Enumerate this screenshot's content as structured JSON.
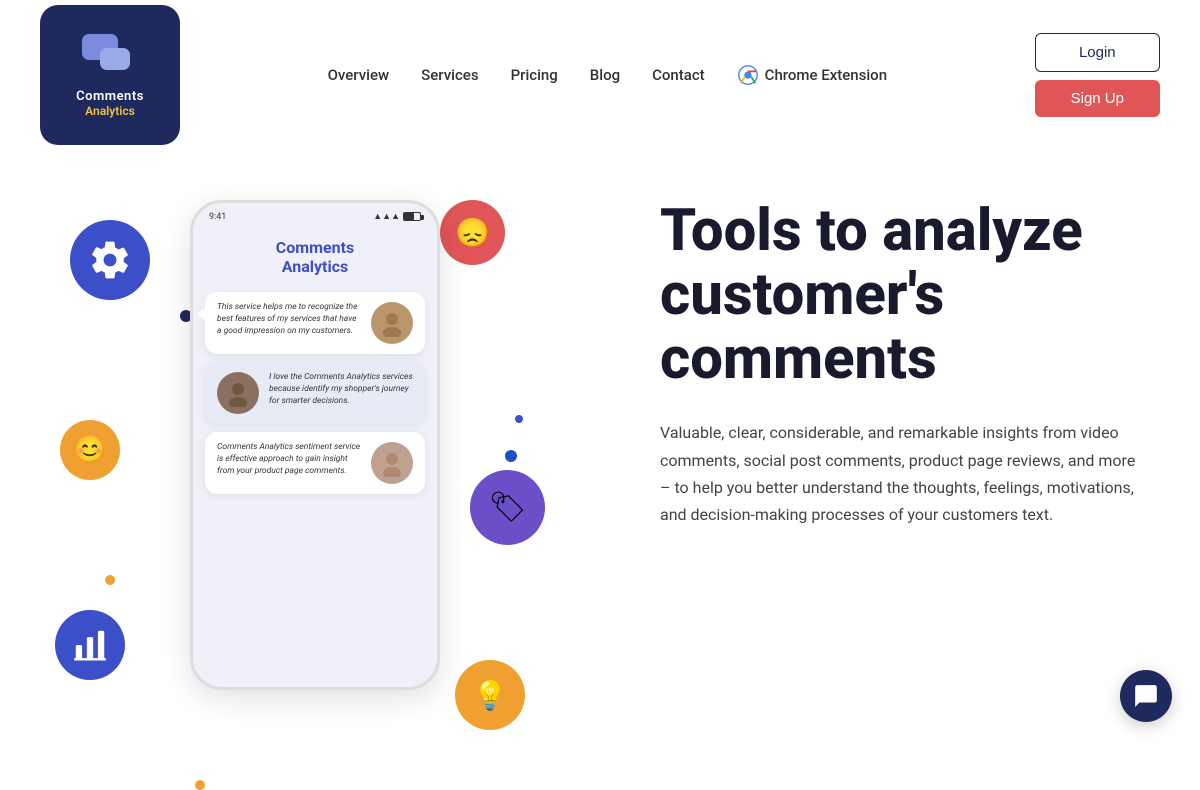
{
  "logo": {
    "text_comments": "Comments",
    "text_analytics": "Analytics"
  },
  "nav": {
    "overview": "Overview",
    "services": "Services",
    "pricing": "Pricing",
    "blog": "Blog",
    "contact": "Contact",
    "chrome_extension": "Chrome Extension"
  },
  "header_buttons": {
    "login": "Login",
    "signup": "Sign Up"
  },
  "hero": {
    "title_line1": "Tools to analyze",
    "title_line2": "customer's",
    "title_line3": "comments",
    "description": "Valuable, clear, considerable, and remarkable insights from video comments, social post comments, product page reviews, and more – to help you better understand the thoughts, feelings, motivations, and decision-making processes of your customers text."
  },
  "phone": {
    "app_title_line1": "Comments",
    "app_title_line2": "Analytics",
    "comment1": "This service helps me to recognize the best features of my services that have a good impression on my customers.",
    "comment2": "I love the Comments Analytics services because identify my shopper's journey for smarter decisions.",
    "comment3": "Comments Analytics sentiment service is effective approach to gain insight from your product page comments."
  },
  "decorators": {
    "dot1_top": "140",
    "dot1_left": "140",
    "dot2_top": "315",
    "dot2_left": "475",
    "dot3_top": "380",
    "dot3_left": "65",
    "dot4_top": "610",
    "dot4_left": "155"
  }
}
